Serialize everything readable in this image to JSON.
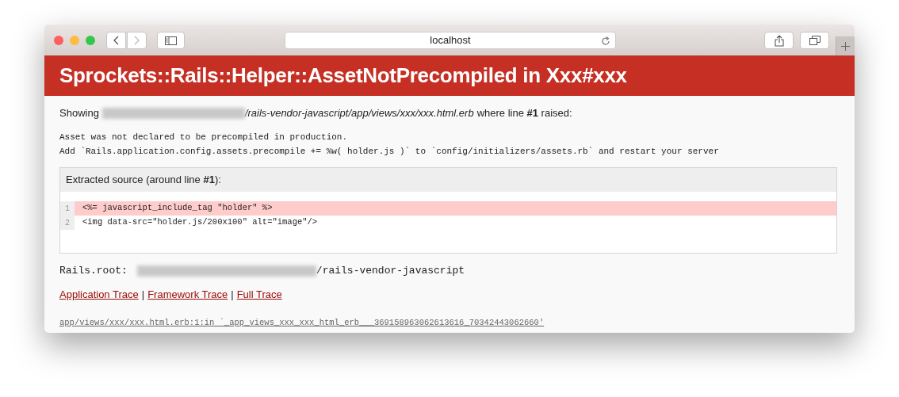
{
  "browser": {
    "address": "localhost"
  },
  "error": {
    "title": "Sprockets::Rails::Helper::AssetNotPrecompiled in Xxx#xxx",
    "showing_label": "Showing",
    "file_path": "/rails-vendor-javascript/app/views/xxx/xxx.html.erb",
    "raised_text": "where line **#1** raised:",
    "message_lines": [
      "Asset was not declared to be precompiled in production.",
      "Add `Rails.application.config.assets.precompile += %w( holder.js )` to `config/initializers/assets.rb` and restart your server"
    ]
  },
  "source": {
    "heading": "Extracted source (around line **#1**):",
    "lines": [
      {
        "number": "1",
        "code": "<%= javascript_include_tag \"holder\" %>",
        "highlighted": true
      },
      {
        "number": "2",
        "code": "<img data-src=\"holder.js/200x100\" alt=\"image\"/>",
        "highlighted": false
      }
    ]
  },
  "rails_root": {
    "label": "Rails.root:",
    "path": "/rails-vendor-javascript"
  },
  "trace_links": [
    {
      "label": "Application Trace"
    },
    {
      "label": "Framework Trace"
    },
    {
      "label": "Full Trace"
    }
  ],
  "trace_separators": [
    "|",
    "|"
  ],
  "trace_line": "app/views/xxx/xxx.html.erb:1:in `_app_views_xxx_xxx_html_erb___369158963062613616_70342443062660'"
}
